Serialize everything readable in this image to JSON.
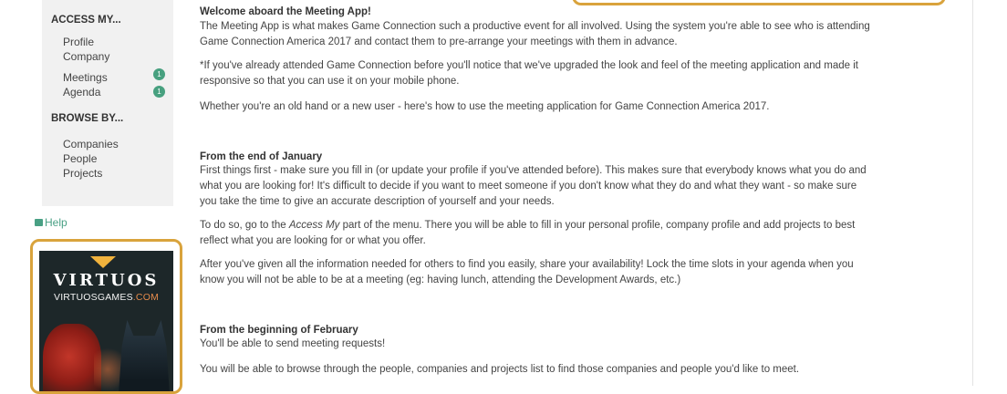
{
  "sidebar": {
    "access_title": "ACCESS MY...",
    "access_items": [
      {
        "label": "Profile"
      },
      {
        "label": "Company"
      },
      {
        "label": "Meetings",
        "badge": "1"
      },
      {
        "label": "Agenda",
        "badge": "1"
      }
    ],
    "browse_title": "BROWSE BY...",
    "browse_items": [
      {
        "label": "Companies"
      },
      {
        "label": "People"
      },
      {
        "label": "Projects"
      }
    ],
    "help_label": "Help",
    "help_icon": "camera-icon"
  },
  "ad": {
    "logo": "VIRTUOS",
    "url_main": "VIRTUOSGAMES",
    "url_accent": ".COM"
  },
  "main": {
    "welcome_title": "Welcome aboard the Meeting App!",
    "welcome_line1": "The Meeting App is what makes Game Connection such a productive event for all involved. Using the system you're able to see who is attending",
    "welcome_line2": "Game Connection America 2017 and contact them to pre-arrange your meetings with them in advance.",
    "note_line1": "*If you've already attended Game Connection before you'll notice that we've upgraded the look and feel of the meeting application and made it",
    "note_line2": "responsive so that you can use it on your mobile phone.",
    "whether_line": "Whether you're an old hand or a new user - here's how to use the meeting application for Game Connection America 2017.",
    "january_title": "From the end of January",
    "january_line1": "First things first - make sure you fill in (or update your profile if you've attended before). This makes sure that everybody knows what you do and",
    "january_line2": "what you are looking for! It's difficult to decide if you want to meet someone if you don't know what they do and what they want - so make sure",
    "january_line3": "you take the time to give an accurate description of yourself and your needs.",
    "todo_prefix": "To do so, go to the ",
    "todo_emphasis": "Access My",
    "todo_suffix": " part of the menu. There you will be able to fill in your personal profile, company profile and add projects to best",
    "todo_line2": "reflect what you are looking for or what you offer.",
    "after_line1": "After you've given all the information needed for others to find you easily, share your availability! Lock the time slots in your agenda when you",
    "after_line2": "know you will not be able to be at a meeting (eg: having lunch, attending the Development Awards, etc.)",
    "february_title": "From the beginning of February",
    "february_line1": "You'll be able to send meeting requests!",
    "browse_line": "You will be able to browse through the people, companies and projects list to find those companies and people you'd like to meet."
  },
  "colors": {
    "accent_green": "#47a07f",
    "highlight_gold": "#d9a33c",
    "sidebar_bg": "#f1f1f1"
  }
}
